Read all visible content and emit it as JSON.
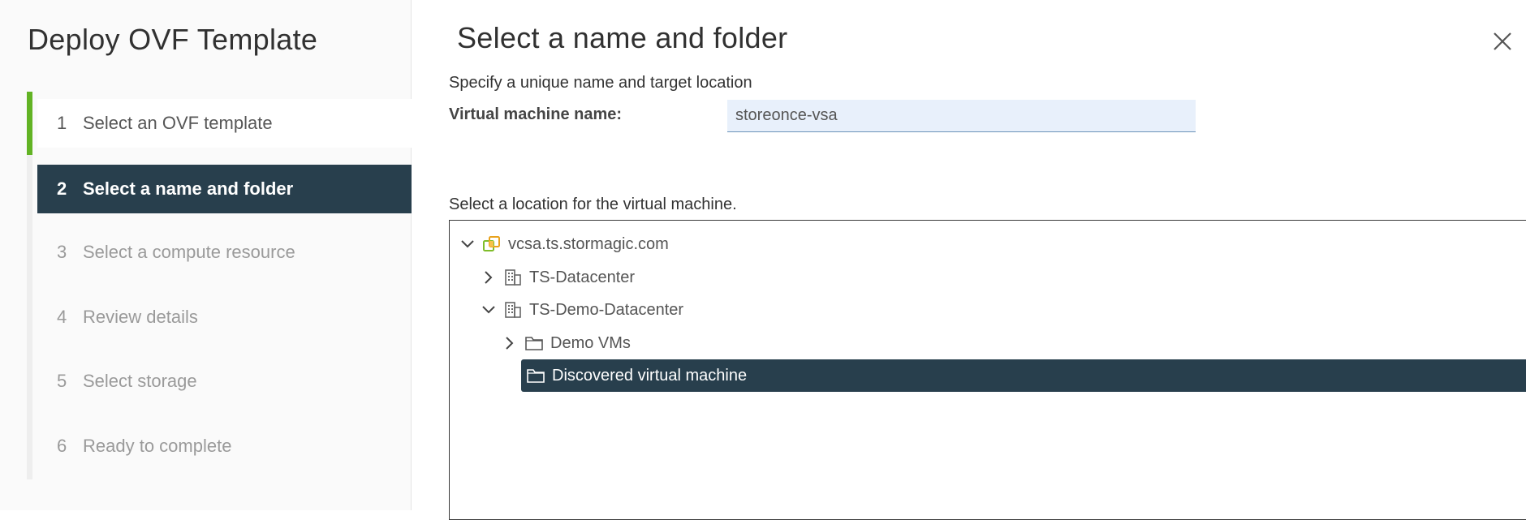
{
  "sidebar": {
    "title": "Deploy OVF Template",
    "steps": [
      {
        "num": "1",
        "label": "Select an OVF template"
      },
      {
        "num": "2",
        "label": "Select a name and folder"
      },
      {
        "num": "3",
        "label": "Select a compute resource"
      },
      {
        "num": "4",
        "label": "Review details"
      },
      {
        "num": "5",
        "label": "Select storage"
      },
      {
        "num": "6",
        "label": "Ready to complete"
      }
    ]
  },
  "main": {
    "title": "Select a name and folder",
    "subtitle": "Specify a unique name and target location",
    "vm_name_label": "Virtual machine name:",
    "vm_name_value": "storeonce-vsa",
    "location_label": "Select a location for the virtual machine."
  },
  "tree": {
    "nodes": [
      {
        "label": "vcsa.ts.stormagic.com",
        "icon": "vcenter-icon",
        "expanded": true
      },
      {
        "label": "TS-Datacenter",
        "icon": "datacenter-icon",
        "expanded": false
      },
      {
        "label": "TS-Demo-Datacenter",
        "icon": "datacenter-icon",
        "expanded": true
      },
      {
        "label": "Demo VMs",
        "icon": "folder-icon",
        "expanded": false
      },
      {
        "label": "Discovered virtual machine",
        "icon": "folder-icon",
        "selected": true
      }
    ]
  },
  "colors": {
    "accent": "#283f4d",
    "progress": "#62b324",
    "input_bg": "#e8f0fb"
  }
}
